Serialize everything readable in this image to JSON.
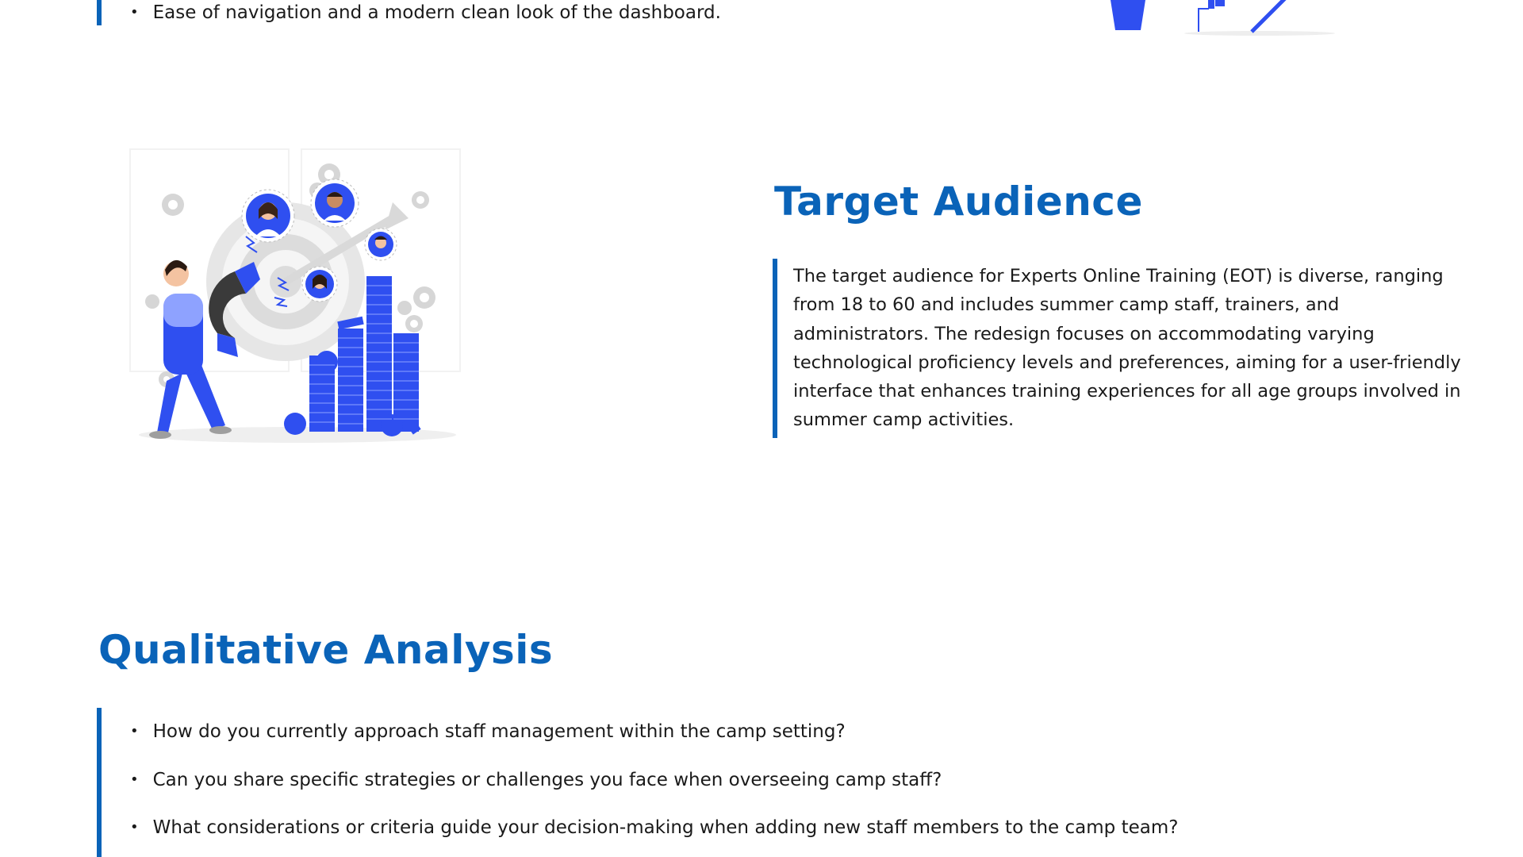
{
  "top": {
    "bullet": "Ease of navigation and a modern clean look of the dashboard."
  },
  "target_audience": {
    "title": "Target Audience",
    "body": "The target audience for Experts Online Training (EOT) is diverse, ranging from 18 to 60 and includes summer camp staff, trainers, and administrators. The redesign focuses on accommodating varying technological proficiency levels and preferences, aiming for a user-friendly interface that enhances training experiences for all age groups involved in summer camp activities."
  },
  "qualitative_analysis": {
    "title": "Qualitative Analysis",
    "questions": [
      "How do you currently approach staff management within the camp setting?",
      "Can you share specific strategies or challenges you face when overseeing camp staff?",
      "What considerations or criteria guide your decision-making when adding new staff members to the camp team?"
    ]
  },
  "colors": {
    "accent": "#0a63b8",
    "illustration_blue": "#2f4ff0",
    "text": "#1a1a1a"
  },
  "icons": [
    "magnet-illustration",
    "coin-stack-illustration",
    "target-illustration",
    "gear-icon",
    "avatar-icon"
  ]
}
